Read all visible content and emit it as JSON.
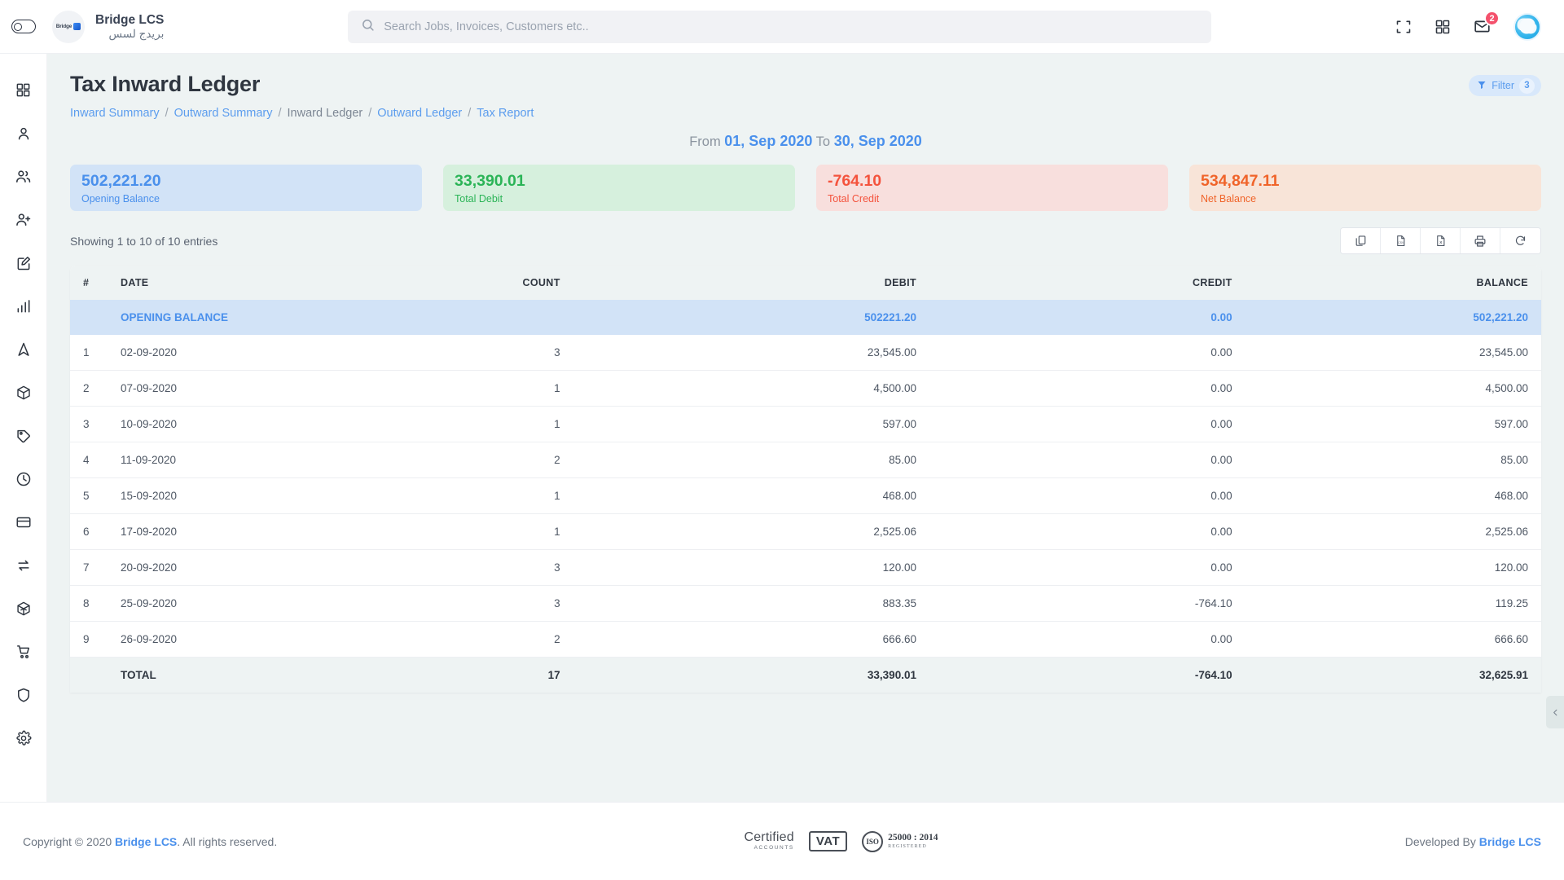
{
  "colors": {
    "accent_blue": "#4a90ec",
    "link_blue": "#5c9dee",
    "green": "#2bb457",
    "red": "#f4533d",
    "orange": "#f0642a",
    "page_bg": "#eef3f3"
  },
  "topbar": {
    "sidebar_toggle": "sidebar-toggle",
    "brand_name": "Bridge LCS",
    "brand_name_ar": "بريدج لسس",
    "logo_text": "Bridge",
    "search_placeholder": "Search Jobs, Invoices, Customers etc..",
    "search_value": "",
    "icons": [
      "fullscreen-icon",
      "apps-grid-icon",
      "mail-icon"
    ],
    "mail_badge": "2"
  },
  "sidebar": {
    "items": [
      {
        "name": "dashboard",
        "icon": "grid-icon"
      },
      {
        "name": "profile",
        "icon": "user-icon"
      },
      {
        "name": "customers",
        "icon": "users-icon"
      },
      {
        "name": "add-user",
        "icon": "user-add-icon"
      },
      {
        "name": "jobs",
        "icon": "edit-square-icon"
      },
      {
        "name": "reports",
        "icon": "bar-chart-icon"
      },
      {
        "name": "tracking",
        "icon": "navigation-icon"
      },
      {
        "name": "packages",
        "icon": "box-icon"
      },
      {
        "name": "pricing",
        "icon": "tag-icon"
      },
      {
        "name": "history",
        "icon": "clock-icon"
      },
      {
        "name": "payments",
        "icon": "card-icon"
      },
      {
        "name": "transfers",
        "icon": "exchange-icon"
      },
      {
        "name": "inventory",
        "icon": "cube-icon"
      },
      {
        "name": "purchase",
        "icon": "cart-icon"
      },
      {
        "name": "security",
        "icon": "shield-icon"
      },
      {
        "name": "settings",
        "icon": "gear-icon"
      }
    ]
  },
  "page": {
    "title": "Tax Inward Ledger",
    "breadcrumb": [
      {
        "label": "Inward Summary",
        "active": false
      },
      {
        "label": "Outward Summary",
        "active": false
      },
      {
        "label": "Inward Ledger",
        "active": true
      },
      {
        "label": "Outward Ledger",
        "active": false
      },
      {
        "label": "Tax Report",
        "active": false
      }
    ],
    "separator": "/",
    "filter_label": "Filter",
    "filter_count": "3",
    "date_from_label": "From",
    "date_from": "01, Sep 2020",
    "date_to_label": "To",
    "date_to": "30, Sep 2020"
  },
  "cards": [
    {
      "value": "502,221.20",
      "label": "Opening Balance",
      "bg": "#d2e3f7",
      "fg": "#4a90ec"
    },
    {
      "value": "33,390.01",
      "label": "Total Debit",
      "bg": "#d6f0dd",
      "fg": "#2bb457"
    },
    {
      "value": "-764.10",
      "label": "Total Credit",
      "bg": "#f8dfdd",
      "fg": "#f4533d"
    },
    {
      "value": "534,847.11",
      "label": "Net Balance",
      "bg": "#f8e4d8",
      "fg": "#f0642a"
    }
  ],
  "table": {
    "showing": "Showing 1 to 10 of 10 entries",
    "tools": [
      {
        "name": "copy-button",
        "icon": "copy-icon"
      },
      {
        "name": "csv-export-button",
        "icon": "csv-file-icon"
      },
      {
        "name": "excel-export-button",
        "icon": "excel-file-icon"
      },
      {
        "name": "print-button",
        "icon": "printer-icon"
      },
      {
        "name": "refresh-button",
        "icon": "refresh-icon"
      }
    ],
    "headers": [
      "#",
      "DATE",
      "COUNT",
      "DEBIT",
      "CREDIT",
      "BALANCE"
    ],
    "opening": {
      "label": "OPENING BALANCE",
      "count": "",
      "debit": "502221.20",
      "credit": "0.00",
      "balance": "502,221.20"
    },
    "rows": [
      {
        "num": "1",
        "date": "02-09-2020",
        "count": "3",
        "debit": "23,545.00",
        "credit": "0.00",
        "balance": "23,545.00"
      },
      {
        "num": "2",
        "date": "07-09-2020",
        "count": "1",
        "debit": "4,500.00",
        "credit": "0.00",
        "balance": "4,500.00"
      },
      {
        "num": "3",
        "date": "10-09-2020",
        "count": "1",
        "debit": "597.00",
        "credit": "0.00",
        "balance": "597.00"
      },
      {
        "num": "4",
        "date": "11-09-2020",
        "count": "2",
        "debit": "85.00",
        "credit": "0.00",
        "balance": "85.00"
      },
      {
        "num": "5",
        "date": "15-09-2020",
        "count": "1",
        "debit": "468.00",
        "credit": "0.00",
        "balance": "468.00"
      },
      {
        "num": "6",
        "date": "17-09-2020",
        "count": "1",
        "debit": "2,525.06",
        "credit": "0.00",
        "balance": "2,525.06"
      },
      {
        "num": "7",
        "date": "20-09-2020",
        "count": "3",
        "debit": "120.00",
        "credit": "0.00",
        "balance": "120.00"
      },
      {
        "num": "8",
        "date": "25-09-2020",
        "count": "3",
        "debit": "883.35",
        "credit": "-764.10",
        "balance": "119.25"
      },
      {
        "num": "9",
        "date": "26-09-2020",
        "count": "2",
        "debit": "666.60",
        "credit": "0.00",
        "balance": "666.60"
      }
    ],
    "total": {
      "label": "TOTAL",
      "count": "17",
      "debit": "33,390.01",
      "credit": "-764.10",
      "balance": "32,625.91"
    }
  },
  "footer": {
    "copyright_pre": "Copyright © 2020 ",
    "copyright_link": "Bridge LCS",
    "copyright_post": ". All rights reserved.",
    "badges": {
      "certified_main": "Certified",
      "certified_sub": "ACCOUNTS",
      "vat": "VAT",
      "iso_seal": "ISO",
      "iso_number": "25000 : 2014",
      "iso_registered": "REGISTERED"
    },
    "developed_pre": "Developed By ",
    "developed_link": "Bridge LCS"
  }
}
